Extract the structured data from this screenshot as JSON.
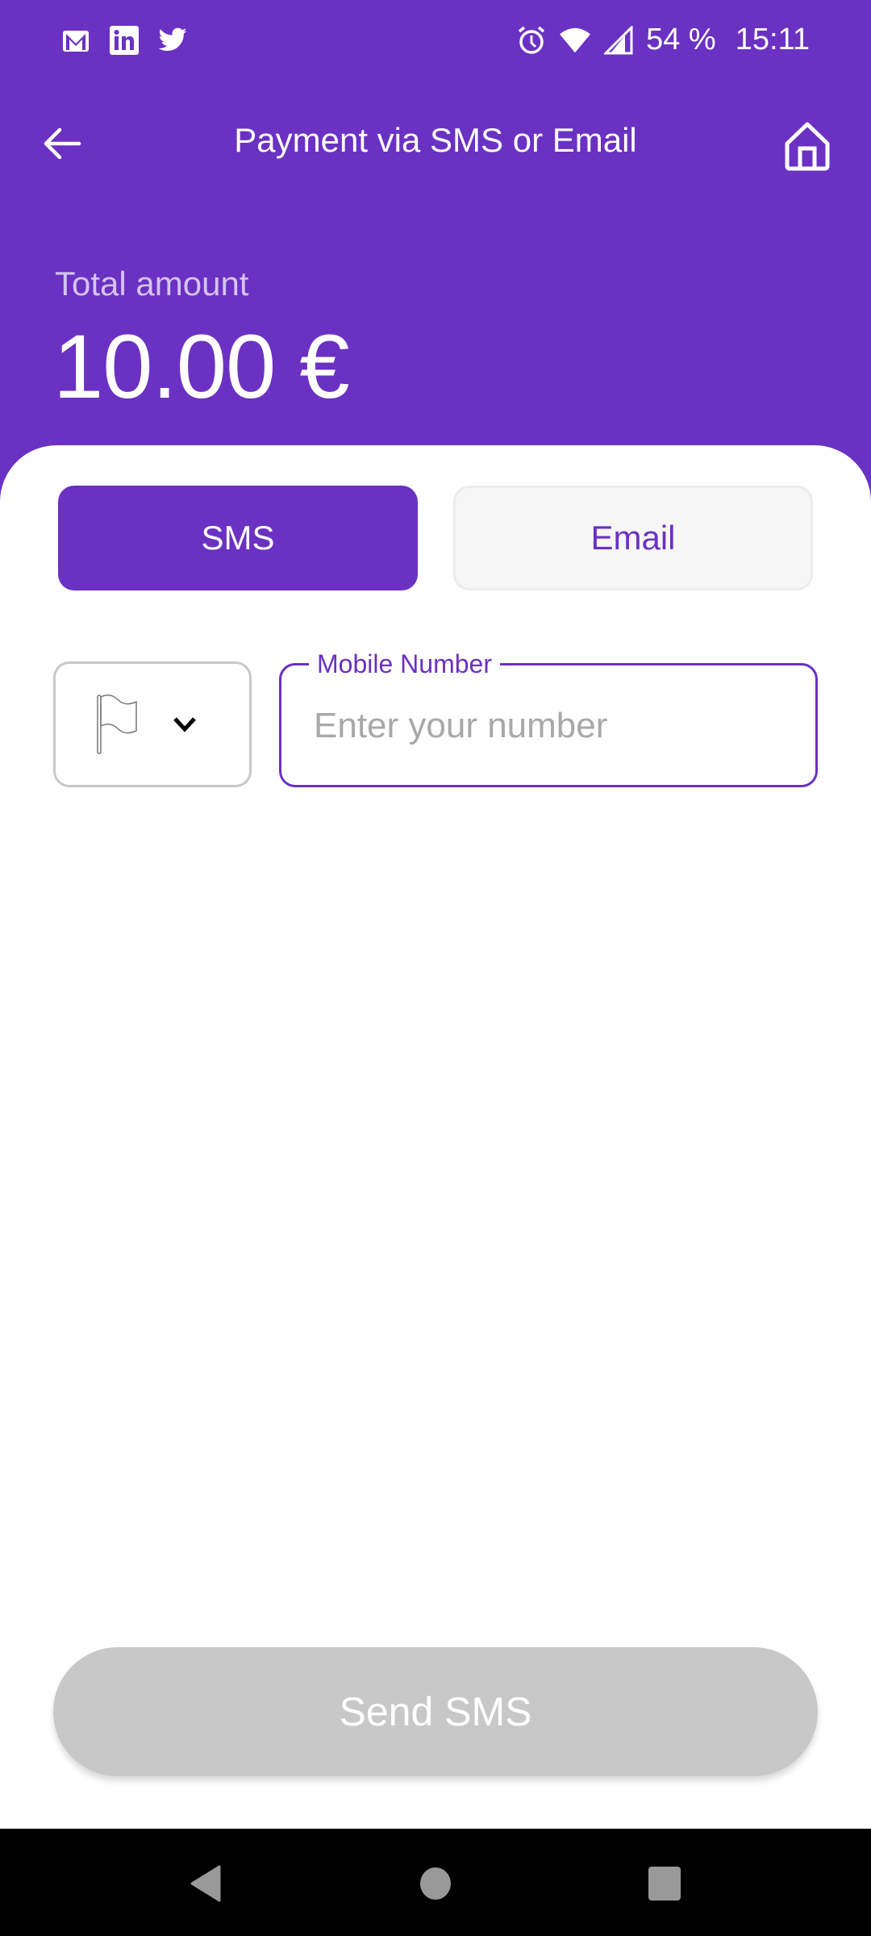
{
  "status_bar": {
    "notification_icons": [
      "gmail-icon",
      "linkedin-icon",
      "twitter-icon"
    ],
    "system_icons": [
      "alarm-icon",
      "wifi-icon",
      "signal-icon"
    ],
    "battery": "54 %",
    "time": "15:11"
  },
  "app_bar": {
    "title": "Payment via SMS or Email",
    "back_icon": "arrow-left-icon",
    "home_icon": "home-icon"
  },
  "summary": {
    "total_label": "Total amount",
    "total_value": "10.00 €"
  },
  "tabs": [
    {
      "label": "SMS",
      "selected": true
    },
    {
      "label": "Email",
      "selected": false
    }
  ],
  "form": {
    "country_selector": {
      "icon": "flag-icon",
      "chevron": "chevron-down-icon"
    },
    "mobile_number": {
      "label": "Mobile Number",
      "placeholder": "Enter your number",
      "value": ""
    }
  },
  "actions": {
    "send_label": "Send SMS",
    "send_enabled": false
  },
  "colors": {
    "primary": "#6a31c2",
    "disabled": "#c8c8c8"
  },
  "nav_bar": [
    "back",
    "home",
    "recents"
  ]
}
